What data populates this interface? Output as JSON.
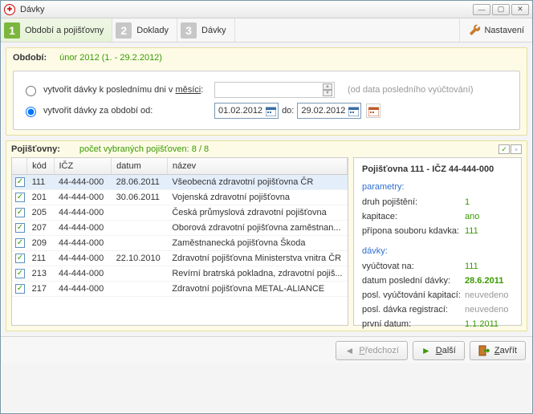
{
  "window": {
    "title": "Dávky"
  },
  "wizard": {
    "steps": [
      {
        "num": "1",
        "label": "Období a pojišťovny",
        "active": true
      },
      {
        "num": "2",
        "label": "Doklady",
        "active": false
      },
      {
        "num": "3",
        "label": "Dávky",
        "active": false
      }
    ],
    "settings_label": "Nastavení"
  },
  "period": {
    "label": "Období:",
    "value": "únor 2012 (1. - 29.2.2012)",
    "opt_month_prefix": "vytvořit dávky k poslednímu dni v ",
    "opt_month_word": "měsíci",
    "opt_month_suffix": ":",
    "month_hint": "(od data posledního vyúčtování)",
    "opt_range": "vytvořit dávky za období od:",
    "date_from": "01.02.2012",
    "date_to_label": "do:",
    "date_to": "29.02.2012",
    "selected": "range"
  },
  "insurers_header": {
    "label": "Pojišťovny:",
    "count_text": "počet vybraných pojišťoven: 8 / 8"
  },
  "columns": {
    "kod": "kód",
    "icz": "IČZ",
    "datum": "datum",
    "nazev": "název"
  },
  "rows": [
    {
      "checked": true,
      "selected": true,
      "kod": "111",
      "icz": "44-444-000",
      "datum": "28.06.2011",
      "nazev": "Všeobecná zdravotní pojišťovna ČR"
    },
    {
      "checked": true,
      "selected": false,
      "kod": "201",
      "icz": "44-444-000",
      "datum": "30.06.2011",
      "nazev": "Vojenská zdravotní pojišťovna"
    },
    {
      "checked": true,
      "selected": false,
      "kod": "205",
      "icz": "44-444-000",
      "datum": "",
      "nazev": "Česká průmyslová zdravotní pojišťovna"
    },
    {
      "checked": true,
      "selected": false,
      "kod": "207",
      "icz": "44-444-000",
      "datum": "",
      "nazev": "Oborová zdravotní pojišťovna zaměstnan..."
    },
    {
      "checked": true,
      "selected": false,
      "kod": "209",
      "icz": "44-444-000",
      "datum": "",
      "nazev": "Zaměstnanecká pojišťovna Škoda"
    },
    {
      "checked": true,
      "selected": false,
      "kod": "211",
      "icz": "44-444-000",
      "datum": "22.10.2010",
      "nazev": "Zdravotní pojišťovna Ministerstva vnitra ČR"
    },
    {
      "checked": true,
      "selected": false,
      "kod": "213",
      "icz": "44-444-000",
      "datum": "",
      "nazev": "Revírní bratrská pokladna, zdravotní pojiš..."
    },
    {
      "checked": true,
      "selected": false,
      "kod": "217",
      "icz": "44-444-000",
      "datum": "",
      "nazev": "Zdravotní pojišťovna METAL-ALIANCE"
    }
  ],
  "detail": {
    "title": "Pojišťovna 111 - IČZ 44-444-000",
    "param_head": "parametry:",
    "param_rows": [
      {
        "k": "druh pojištění:",
        "v": "1",
        "style": "normal"
      },
      {
        "k": "kapitace:",
        "v": "ano",
        "style": "normal"
      },
      {
        "k": "přípona souboru kdavka:",
        "v": "111",
        "style": "normal"
      }
    ],
    "davky_head": "dávky:",
    "davky_rows": [
      {
        "k": "vyúčtovat na:",
        "v": "111",
        "style": "normal"
      },
      {
        "k": "datum poslední dávky:",
        "v": "28.6.2011",
        "style": "bold"
      },
      {
        "k": "posl. vyúčtování kapitací:",
        "v": "neuvedeno",
        "style": "grey"
      },
      {
        "k": "posl. dávka registrací:",
        "v": "neuvedeno",
        "style": "grey"
      },
      {
        "k": "první datum:",
        "v": "1.1.2011",
        "style": "normal"
      }
    ]
  },
  "footer": {
    "prev": "Předchozí",
    "next": "Další",
    "close": "Zavřít"
  }
}
